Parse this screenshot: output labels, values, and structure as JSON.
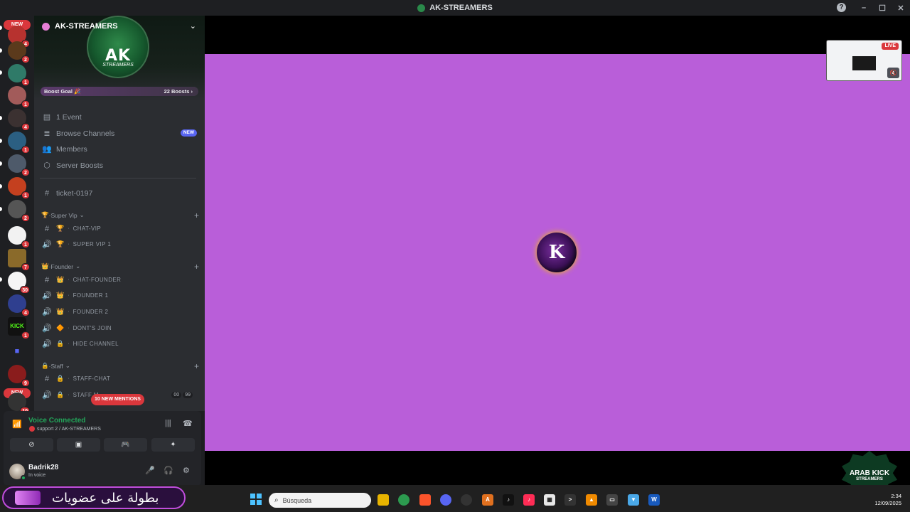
{
  "window": {
    "title": "AK-STREAMERS",
    "controls": [
      "–",
      "☐",
      "✕"
    ]
  },
  "rail": {
    "new_label": "NEW",
    "servers": [
      {
        "badge": "4",
        "color": "#b7322f"
      },
      {
        "badge": "2",
        "color": "#5b3a1c"
      },
      {
        "badge": "1",
        "color": "#2f7a68"
      },
      {
        "badge": "1",
        "color": "#a25b5a"
      },
      {
        "badge": "4",
        "color": "#3b3131"
      },
      {
        "badge": "1",
        "color": "#2b5f82"
      },
      {
        "badge": "2",
        "color": "#4e5a6a"
      },
      {
        "badge": "1",
        "color": "#c4401f"
      },
      {
        "badge": "2",
        "color": "#555555"
      },
      {
        "badge": "1",
        "color": "#f2f2f2"
      },
      {
        "badge": "7",
        "color": "#8a6a2a"
      },
      {
        "badge": "30",
        "color": "#f5f5f5"
      },
      {
        "badge": "4",
        "color": "#2f3f8f"
      },
      {
        "badge": "1",
        "color": "#111111"
      },
      {
        "badge": "",
        "color": "#5865f2"
      },
      {
        "badge": "9",
        "color": "#8a1c1c"
      },
      {
        "badge": "10",
        "color": "#333333"
      }
    ],
    "kick_text": "KICK"
  },
  "server": {
    "name": "AK-STREAMERS",
    "logo_text": "AK",
    "logo_sub": "STREAMERS",
    "boost_goal": "Boost Goal 🎉",
    "boost_count": "22 Boosts ›"
  },
  "nav": {
    "events": "1 Event",
    "browse": "Browse Channels",
    "browse_badge": "NEW",
    "members": "Members",
    "boosts": "Server Boosts"
  },
  "channels": {
    "ticket": "ticket-0197",
    "cat_supervip": "Super Vip",
    "chat_vip": "chat-vip",
    "super_vip_1": "super vip 1",
    "cat_founder": "Founder",
    "chat_founder": "chat-founder",
    "founder_1": "founder 1",
    "founder_2": "founder 2",
    "dont_join": "dont's join",
    "hide_channel": "hide channel",
    "cat_staff": "Staff",
    "staff_chat": "staff-chat",
    "staff_m": "staff m",
    "count_a": "00",
    "count_b": "99",
    "mentions": "10 NEW MENTIONS"
  },
  "voice": {
    "status": "Voice Connected",
    "location": "support 2 / AK-STREAMERS"
  },
  "user": {
    "name": "Badrik28",
    "status": "In voice"
  },
  "stream": {
    "live": "LIVE",
    "center_logo": "K",
    "watermark_1": "ARAB KICK",
    "watermark_2": "STREAMERS"
  },
  "taskbar": {
    "promo": "بطولة على عضويات",
    "search": "Búsqueda",
    "time": "2:34",
    "date": "12/09/2025"
  }
}
